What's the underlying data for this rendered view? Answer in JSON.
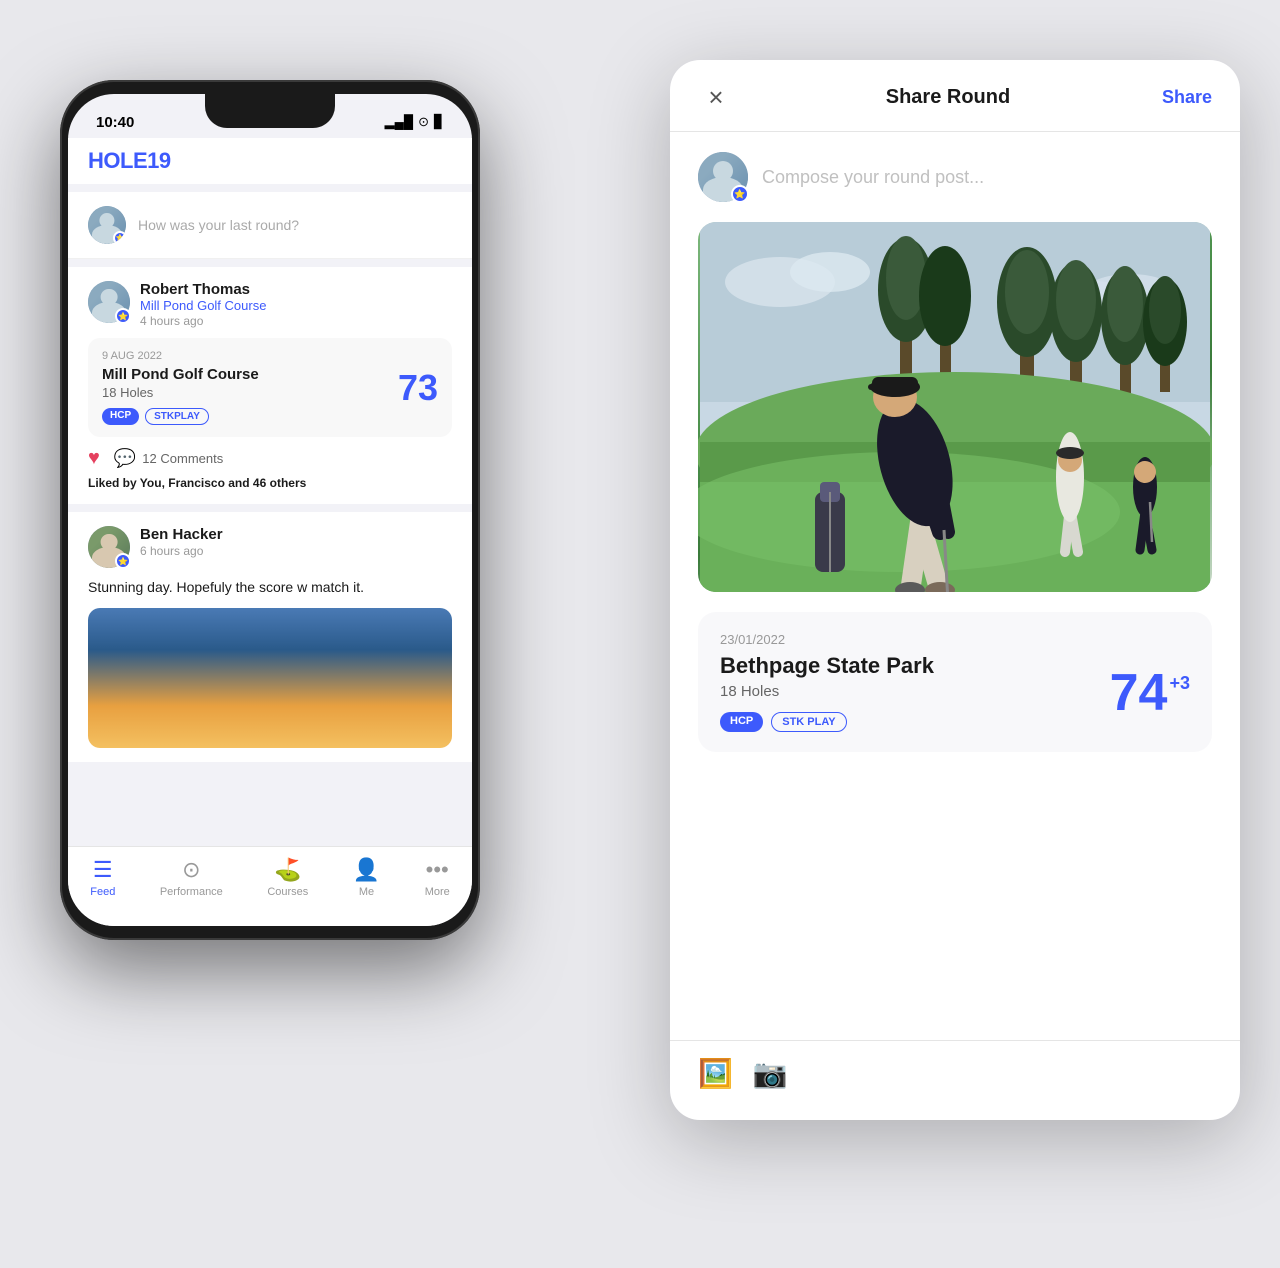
{
  "app": {
    "logo": "HOLE19",
    "status_time": "10:40"
  },
  "phone": {
    "post_prompt": "How was your last round?",
    "feed": [
      {
        "user": "Robert Thomas",
        "course": "Mill Pond Golf Course",
        "time": "4 hours ago",
        "round_date": "9 AUG 2022",
        "round_course": "Mill Pond Golf Course",
        "round_holes": "18 Holes",
        "round_score": "73",
        "tags": [
          "HCP",
          "STKPLAY"
        ],
        "comments_count": "12 Comments",
        "liked_by": "Liked by You, Francisco and 46 others"
      },
      {
        "user": "Ben Hacker",
        "time": "6 hours ago",
        "post_text": "Stunning day. Hopefuly the score w match it."
      }
    ],
    "nav": [
      {
        "label": "Feed",
        "active": true
      },
      {
        "label": "Performance",
        "active": false
      },
      {
        "label": "Courses",
        "active": false
      },
      {
        "label": "Me",
        "active": false
      },
      {
        "label": "More",
        "active": false
      }
    ]
  },
  "modal": {
    "title": "Share Round",
    "close_label": "×",
    "share_label": "Share",
    "compose_placeholder": "Compose your round post...",
    "round": {
      "date": "23/01/2022",
      "course_name": "Bethpage State Park",
      "holes": "18 Holes",
      "score": "74",
      "score_diff": "+3",
      "tags": [
        "HCP",
        "STK PLAY"
      ]
    },
    "toolbar_icons": [
      "gallery",
      "camera"
    ]
  },
  "icons": {
    "star": "⭐",
    "heart": "♥",
    "comment": "💬",
    "gallery": "🖼",
    "camera": "📷",
    "feed_nav": "☰",
    "performance_nav": "⊙",
    "courses_nav": "⛳",
    "me_nav": "👤",
    "more_nav": "…",
    "close": "✕",
    "signal": "▂▄█"
  }
}
